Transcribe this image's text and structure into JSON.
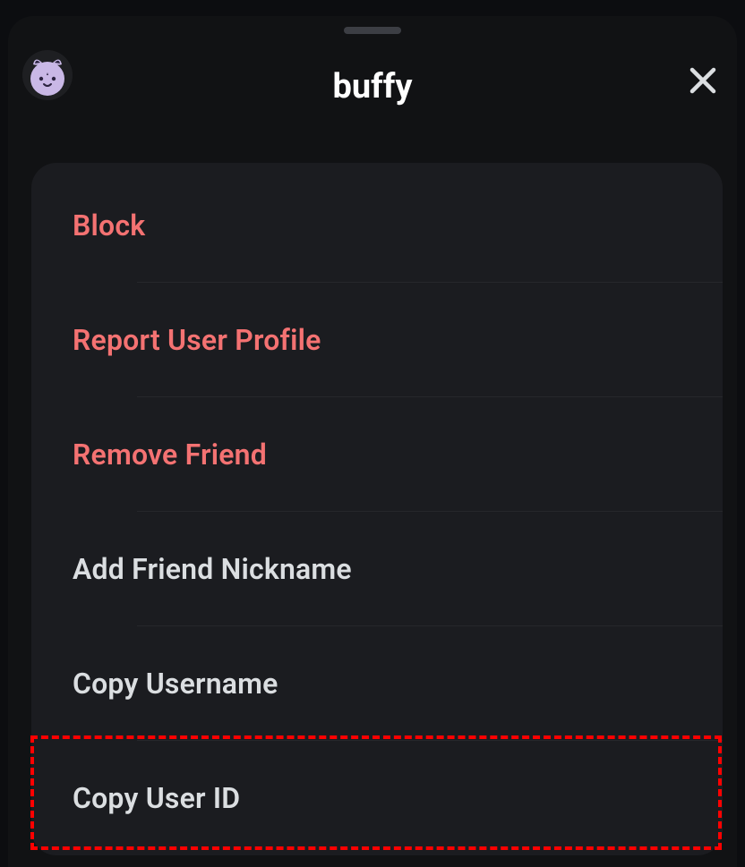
{
  "header": {
    "username": "buffy"
  },
  "menu": {
    "items": [
      {
        "label": "Block",
        "danger": true
      },
      {
        "label": "Report User Profile",
        "danger": true
      },
      {
        "label": "Remove Friend",
        "danger": true
      },
      {
        "label": "Add Friend Nickname",
        "danger": false
      },
      {
        "label": "Copy Username",
        "danger": false
      },
      {
        "label": "Copy User ID",
        "danger": false
      }
    ]
  },
  "colors": {
    "danger": "#f47272",
    "text": "#dbdee1",
    "panel": "#1b1c20",
    "sheet": "#111214",
    "bg": "#0c0d10"
  }
}
